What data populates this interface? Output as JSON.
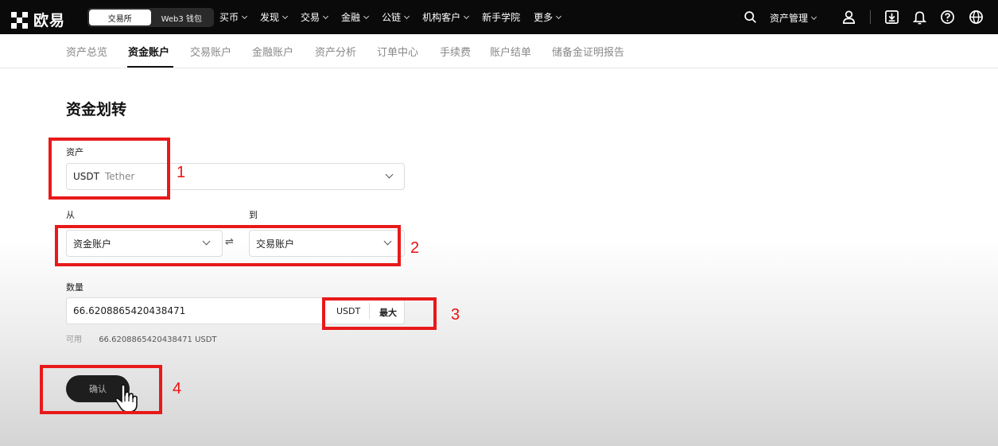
{
  "header": {
    "logo_text": "欧易",
    "modes": [
      "交易所",
      "Web3 钱包"
    ],
    "nav": [
      "买币",
      "发现",
      "交易",
      "金融",
      "公链",
      "机构客户",
      "新手学院",
      "更多"
    ],
    "nav_has_dropdown": [
      true,
      true,
      true,
      true,
      true,
      true,
      false,
      true
    ],
    "asset_mgmt": "资产管理",
    "icons": [
      "search-icon",
      "user-icon",
      "download-icon",
      "bell-icon",
      "help-icon",
      "globe-icon"
    ]
  },
  "subnav": {
    "tabs": [
      "资产总览",
      "资金账户",
      "交易账户",
      "金融账户",
      "资产分析",
      "订单中心",
      "手续费",
      "账户结单",
      "储备金证明报告"
    ],
    "active_index": 1
  },
  "form": {
    "title": "资金划转",
    "asset_label": "资产",
    "asset_symbol": "USDT",
    "asset_name": "Tether",
    "from_label": "从",
    "to_label": "到",
    "from_value": "资金账户",
    "to_value": "交易账户",
    "swap_symbol": "⇌",
    "amount_label": "数量",
    "amount_value": "66.6208865420438471",
    "amount_unit": "USDT",
    "max_label": "最大",
    "available_label": "可用",
    "available_value": "66.6208865420438471 USDT",
    "confirm_label": "确认"
  },
  "annotations": {
    "color": "#e8191a",
    "labels": [
      "1",
      "2",
      "3",
      "4"
    ]
  }
}
